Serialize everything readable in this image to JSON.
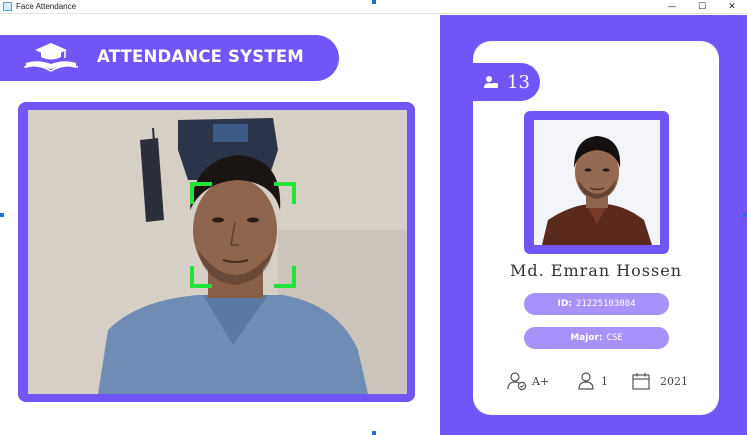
{
  "window": {
    "title": "Face Attendance",
    "controls": {
      "minimize": "—",
      "maximize": "☐",
      "close": "✕"
    }
  },
  "header": {
    "title": "ATTENDANCE SYSTEM",
    "logo_icon": "graduation-book-icon"
  },
  "camera": {
    "detection_box_color": "#22e33a"
  },
  "student": {
    "count_icon": "user-badge-icon",
    "total_attendance_count": "13",
    "name": "Md. Emran Hossen",
    "id_label": "ID:",
    "id_value": "21225103084",
    "major_label": "Major:",
    "major_value": "CSE",
    "standing": "A+",
    "attendance": "1",
    "year": "2021"
  },
  "colors": {
    "accent": "#7155f6",
    "pill": "#a891f8",
    "background": "#ffffff"
  }
}
